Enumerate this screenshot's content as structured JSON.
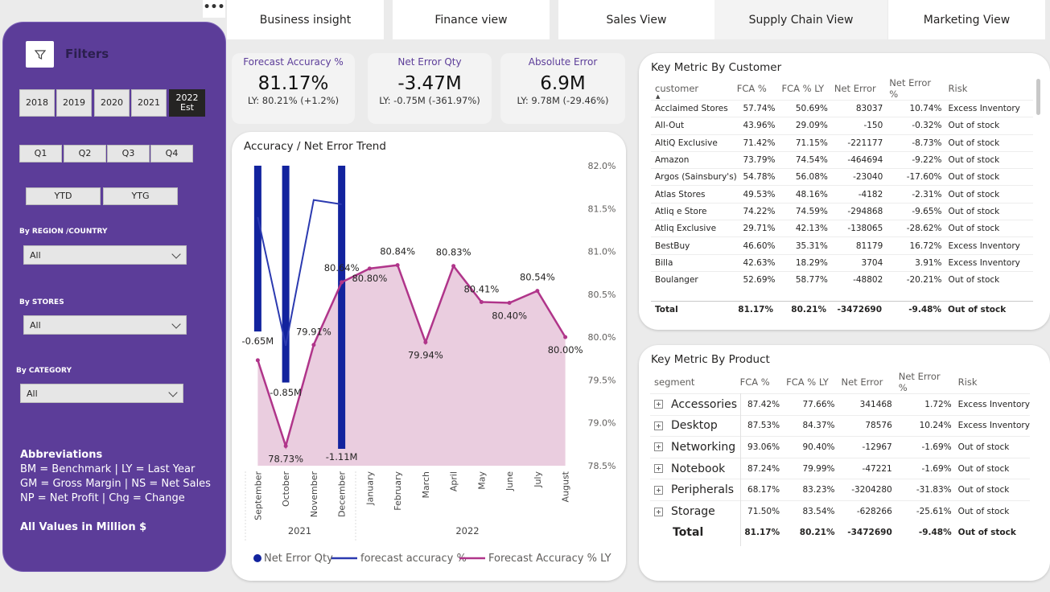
{
  "nav": {
    "more": "•••",
    "tabs": [
      "Business insight",
      "Finance view",
      "Sales View",
      "Supply Chain View",
      "Marketing View"
    ]
  },
  "filters": {
    "title": "Filters",
    "years": [
      "2018",
      "2019",
      "2020",
      "2021"
    ],
    "year_selected_line1": "2022",
    "year_selected_line2": "Est",
    "quarters": [
      "Q1",
      "Q2",
      "Q3",
      "Q4"
    ],
    "period": [
      "YTD",
      "YTG"
    ],
    "region_label": "By REGION /COUNTRY",
    "region_value": "All",
    "stores_label": "By STORES",
    "stores_value": "All",
    "category_label": "By CATEGORY",
    "category_value": "All",
    "abbr_title": "Abbreviations",
    "abbr_lines": [
      "BM = Benchmark | LY = Last Year",
      "GM = Gross Margin | NS = Net Sales",
      "NP = Net Profit | Chg = Change"
    ],
    "values_note": "All Values in Million $"
  },
  "kpis": [
    {
      "title": "Forecast Accuracy %",
      "value": "81.17%",
      "ly": "LY: 80.21% (+1.2%)"
    },
    {
      "title": "Net Error Qty",
      "value": "-3.47M",
      "ly": "LY: -0.75M (-361.97%)"
    },
    {
      "title": "Absolute Error",
      "value": "6.9M",
      "ly": "LY: 9.78M (-29.46%)"
    }
  ],
  "trend": {
    "title": "Accuracy / Net Error Trend",
    "legend": [
      "Net Error Qty",
      "forecast accuracy %",
      "Forecast Accuracy % LY"
    ],
    "colors": {
      "bar": "#12239e",
      "line": "#2b3ab0",
      "ly": "#b0358a",
      "area": "#e8c8dc"
    }
  },
  "chart_data": {
    "type": "line",
    "title": "Accuracy / Net Error Trend",
    "categories": [
      "September",
      "October",
      "November",
      "December",
      "January",
      "February",
      "March",
      "April",
      "May",
      "June",
      "July",
      "August"
    ],
    "year_groups": [
      {
        "label": "2021",
        "count": 4
      },
      {
        "label": "2022",
        "count": 8
      }
    ],
    "y_right_ticks": [
      "82.0%",
      "81.5%",
      "81.0%",
      "80.5%",
      "80.0%",
      "79.5%",
      "79.0%",
      "78.5%"
    ],
    "y_right_range": [
      78.5,
      82.0
    ],
    "series": [
      {
        "name": "Net Error Qty",
        "type": "bar",
        "values": [
          -0.65,
          -0.85,
          null,
          -1.11,
          null,
          null,
          null,
          null,
          null,
          null,
          null,
          null
        ],
        "labels": [
          "-0.65M",
          "-0.85M",
          "",
          "-1.11M",
          "",
          "",
          "",
          "",
          "",
          "",
          "",
          ""
        ]
      },
      {
        "name": "forecast accuracy %",
        "type": "line",
        "values": [
          81.4,
          79.9,
          81.6,
          81.55,
          null,
          null,
          null,
          null,
          null,
          null,
          null,
          null
        ]
      },
      {
        "name": "Forecast Accuracy % LY",
        "type": "area",
        "values": [
          79.73,
          78.73,
          79.91,
          80.64,
          80.8,
          80.84,
          79.94,
          80.83,
          80.41,
          80.4,
          80.54,
          80.0
        ],
        "labels": [
          "",
          "78.73%",
          "79.91%",
          "80.64%",
          "80.80%",
          "80.84%",
          "79.94%",
          "80.83%",
          "80.41%",
          "80.40%",
          "80.54%",
          "80.00%"
        ]
      }
    ]
  },
  "customer_table": {
    "title": "Key Metric By Customer",
    "headers": [
      "customer",
      "FCA %",
      "FCA % LY",
      "Net Error",
      "Net Error %",
      "Risk"
    ],
    "rows": [
      [
        "Acclaimed Stores",
        "57.74%",
        "50.69%",
        "83037",
        "10.74%",
        "Excess Inventory"
      ],
      [
        "All-Out",
        "43.96%",
        "29.09%",
        "-150",
        "-0.32%",
        "Out of stock"
      ],
      [
        "AltiQ Exclusive",
        "71.42%",
        "71.15%",
        "-221177",
        "-8.73%",
        "Out of stock"
      ],
      [
        "Amazon",
        "73.79%",
        "74.54%",
        "-464694",
        "-9.22%",
        "Out of stock"
      ],
      [
        "Argos (Sainsbury's)",
        "54.78%",
        "56.08%",
        "-23040",
        "-17.60%",
        "Out of stock"
      ],
      [
        "Atlas Stores",
        "49.53%",
        "48.16%",
        "-4182",
        "-2.31%",
        "Out of stock"
      ],
      [
        "Atliq e Store",
        "74.22%",
        "74.59%",
        "-294868",
        "-9.65%",
        "Out of stock"
      ],
      [
        "Atliq Exclusive",
        "29.71%",
        "42.13%",
        "-138065",
        "-28.62%",
        "Out of stock"
      ],
      [
        "BestBuy",
        "46.60%",
        "35.31%",
        "81179",
        "16.72%",
        "Excess Inventory"
      ],
      [
        "Billa",
        "42.63%",
        "18.29%",
        "3704",
        "3.91%",
        "Excess Inventory"
      ],
      [
        "Boulanger",
        "52.69%",
        "58.77%",
        "-48802",
        "-20.21%",
        "Out of stock"
      ]
    ],
    "total": [
      "Total",
      "81.17%",
      "80.21%",
      "-3472690",
      "-9.48%",
      "Out of stock"
    ]
  },
  "product_table": {
    "title": "Key Metric By Product",
    "headers": [
      "segment",
      "FCA %",
      "FCA % LY",
      "Net Error",
      "Net Error %",
      "Risk"
    ],
    "rows": [
      [
        "Accessories",
        "87.42%",
        "77.66%",
        "341468",
        "1.72%",
        "Excess Inventory"
      ],
      [
        "Desktop",
        "87.53%",
        "84.37%",
        "78576",
        "10.24%",
        "Excess Inventory"
      ],
      [
        "Networking",
        "93.06%",
        "90.40%",
        "-12967",
        "-1.69%",
        "Out of stock"
      ],
      [
        "Notebook",
        "87.24%",
        "79.99%",
        "-47221",
        "-1.69%",
        "Out of stock"
      ],
      [
        "Peripherals",
        "68.17%",
        "83.23%",
        "-3204280",
        "-31.83%",
        "Out of stock"
      ],
      [
        "Storage",
        "71.50%",
        "83.54%",
        "-628266",
        "-25.61%",
        "Out of stock"
      ]
    ],
    "total": [
      "Total",
      "81.17%",
      "80.21%",
      "-3472690",
      "-9.48%",
      "Out of stock"
    ]
  }
}
